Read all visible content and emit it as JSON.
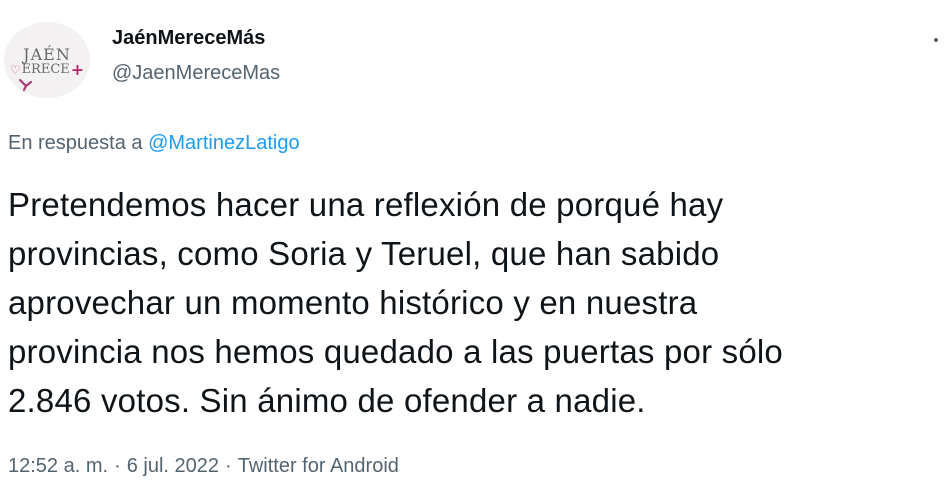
{
  "profile": {
    "avatar_line1": "JAÉN",
    "avatar_line2": "ERECE",
    "avatar_plus": "+",
    "display_name": "JaénMereceMás",
    "handle": "@JaenMereceMas"
  },
  "reply": {
    "prefix": "En respuesta a ",
    "mention": "@MartinezLatigo"
  },
  "tweet": {
    "text": "Pretendemos hacer una reflexión de porqué hay\nprovincias, como Soria y Teruel, que han sabido\naprovechar un momento histórico y en nuestra\nprovincia nos hemos quedado a las puertas por sólo\n2.846 votos. Sin ánimo de ofender a nadie."
  },
  "meta": {
    "time": "12:52 a. m.",
    "separator": "·",
    "date": "6 jul. 2022",
    "source": "Twitter for Android"
  },
  "icons": {
    "more": "more-options-icon",
    "avatar": "avatar"
  },
  "colors": {
    "text_primary": "#0f1419",
    "text_secondary": "#536471",
    "link": "#1d9bf0",
    "avatar_accent": "#b3246f"
  }
}
